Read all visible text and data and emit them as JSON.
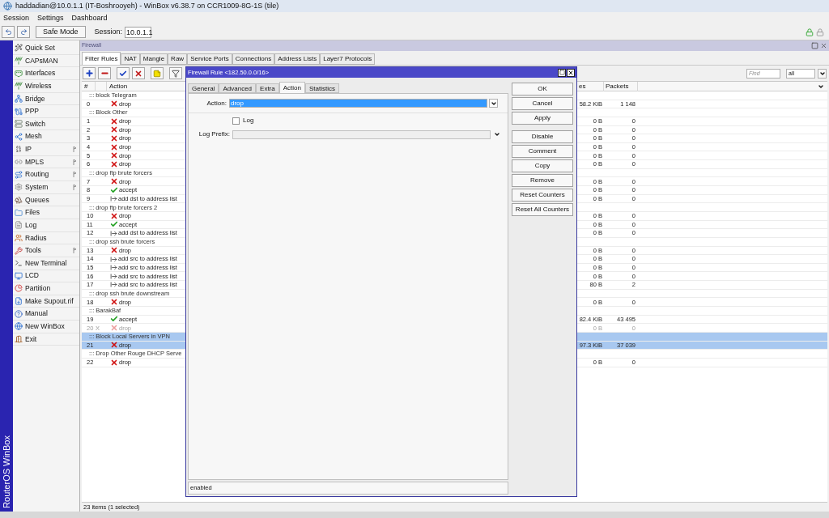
{
  "window": {
    "title": "haddadian@10.0.1.1 (IT-Boshrooyeh) - WinBox v6.38.7 on CCR1009-8G-1S (tile)"
  },
  "menu": [
    "Session",
    "Settings",
    "Dashboard"
  ],
  "toolbar": {
    "safe_mode": "Safe Mode",
    "session_label": "Session:",
    "session_value": "10.0.1.1"
  },
  "sidebar": {
    "brand": "RouterOS WinBox",
    "items": [
      {
        "label": "Quick Set",
        "has_submenu": false
      },
      {
        "label": "CAPsMAN",
        "has_submenu": false
      },
      {
        "label": "Interfaces",
        "has_submenu": false
      },
      {
        "label": "Wireless",
        "has_submenu": false
      },
      {
        "label": "Bridge",
        "has_submenu": false
      },
      {
        "label": "PPP",
        "has_submenu": false
      },
      {
        "label": "Switch",
        "has_submenu": false
      },
      {
        "label": "Mesh",
        "has_submenu": false
      },
      {
        "label": "IP",
        "has_submenu": true
      },
      {
        "label": "MPLS",
        "has_submenu": true
      },
      {
        "label": "Routing",
        "has_submenu": true
      },
      {
        "label": "System",
        "has_submenu": true
      },
      {
        "label": "Queues",
        "has_submenu": false
      },
      {
        "label": "Files",
        "has_submenu": false
      },
      {
        "label": "Log",
        "has_submenu": false
      },
      {
        "label": "Radius",
        "has_submenu": false
      },
      {
        "label": "Tools",
        "has_submenu": true
      },
      {
        "label": "New Terminal",
        "has_submenu": false
      },
      {
        "label": "LCD",
        "has_submenu": false
      },
      {
        "label": "Partition",
        "has_submenu": false
      },
      {
        "label": "Make Supout.rif",
        "has_submenu": false
      },
      {
        "label": "Manual",
        "has_submenu": false
      },
      {
        "label": "New WinBox",
        "has_submenu": false
      },
      {
        "label": "Exit",
        "has_submenu": false
      }
    ]
  },
  "firewall": {
    "title": "Firewall",
    "tabs": [
      {
        "label": "Filter Rules",
        "selected": true
      },
      {
        "label": "NAT",
        "selected": false
      },
      {
        "label": "Mangle",
        "selected": false
      },
      {
        "label": "Raw",
        "selected": false
      },
      {
        "label": "Service Ports",
        "selected": false
      },
      {
        "label": "Connections",
        "selected": false
      },
      {
        "label": "Address Lists",
        "selected": false
      },
      {
        "label": "Layer7 Protocols",
        "selected": false
      }
    ],
    "find_placeholder": "Find",
    "filter_value": "all",
    "columns": [
      "#",
      "Action",
      "es",
      "Packets"
    ],
    "rows": [
      {
        "kind": "comment",
        "text": "::: block Telegram",
        "selected": false
      },
      {
        "kind": "rule",
        "number": "0",
        "disabled": false,
        "action": {
          "kind": "drop",
          "label": "drop"
        },
        "bytes": "58.2 KiB",
        "packets": "1 148",
        "selected": false
      },
      {
        "kind": "comment",
        "text": "::: Block Other",
        "selected": false
      },
      {
        "kind": "rule",
        "number": "1",
        "disabled": false,
        "action": {
          "kind": "drop",
          "label": "drop"
        },
        "bytes": "0 B",
        "packets": "0",
        "selected": false
      },
      {
        "kind": "rule",
        "number": "2",
        "disabled": false,
        "action": {
          "kind": "drop",
          "label": "drop"
        },
        "bytes": "0 B",
        "packets": "0",
        "selected": false
      },
      {
        "kind": "rule",
        "number": "3",
        "disabled": false,
        "action": {
          "kind": "drop",
          "label": "drop"
        },
        "bytes": "0 B",
        "packets": "0",
        "selected": false
      },
      {
        "kind": "rule",
        "number": "4",
        "disabled": false,
        "action": {
          "kind": "drop",
          "label": "drop"
        },
        "bytes": "0 B",
        "packets": "0",
        "selected": false
      },
      {
        "kind": "rule",
        "number": "5",
        "disabled": false,
        "action": {
          "kind": "drop",
          "label": "drop"
        },
        "bytes": "0 B",
        "packets": "0",
        "selected": false
      },
      {
        "kind": "rule",
        "number": "6",
        "disabled": false,
        "action": {
          "kind": "drop",
          "label": "drop"
        },
        "bytes": "0 B",
        "packets": "0",
        "selected": false
      },
      {
        "kind": "comment",
        "text": "::: drop ftp brute forcers",
        "selected": false
      },
      {
        "kind": "rule",
        "number": "7",
        "disabled": false,
        "action": {
          "kind": "drop",
          "label": "drop"
        },
        "bytes": "0 B",
        "packets": "0",
        "selected": false
      },
      {
        "kind": "rule",
        "number": "8",
        "disabled": false,
        "action": {
          "kind": "accept",
          "label": "accept"
        },
        "bytes": "0 B",
        "packets": "0",
        "selected": false
      },
      {
        "kind": "rule",
        "number": "9",
        "disabled": false,
        "action": {
          "kind": "add_to_list",
          "label": "add dst to address list"
        },
        "bytes": "0 B",
        "packets": "0",
        "selected": false
      },
      {
        "kind": "comment",
        "text": "::: drop ftp brute forcers 2",
        "selected": false
      },
      {
        "kind": "rule",
        "number": "10",
        "disabled": false,
        "action": {
          "kind": "drop",
          "label": "drop"
        },
        "bytes": "0 B",
        "packets": "0",
        "selected": false
      },
      {
        "kind": "rule",
        "number": "11",
        "disabled": false,
        "action": {
          "kind": "accept",
          "label": "accept"
        },
        "bytes": "0 B",
        "packets": "0",
        "selected": false
      },
      {
        "kind": "rule",
        "number": "12",
        "disabled": false,
        "action": {
          "kind": "add_to_list",
          "label": "add dst to address list"
        },
        "bytes": "0 B",
        "packets": "0",
        "selected": false
      },
      {
        "kind": "comment",
        "text": "::: drop ssh brute forcers",
        "selected": false
      },
      {
        "kind": "rule",
        "number": "13",
        "disabled": false,
        "action": {
          "kind": "drop",
          "label": "drop"
        },
        "bytes": "0 B",
        "packets": "0",
        "selected": false
      },
      {
        "kind": "rule",
        "number": "14",
        "disabled": false,
        "action": {
          "kind": "add_to_list",
          "label": "add src to address list"
        },
        "bytes": "0 B",
        "packets": "0",
        "selected": false
      },
      {
        "kind": "rule",
        "number": "15",
        "disabled": false,
        "action": {
          "kind": "add_to_list",
          "label": "add src to address list"
        },
        "bytes": "0 B",
        "packets": "0",
        "selected": false
      },
      {
        "kind": "rule",
        "number": "16",
        "disabled": false,
        "action": {
          "kind": "add_to_list",
          "label": "add src to address list"
        },
        "bytes": "0 B",
        "packets": "0",
        "selected": false
      },
      {
        "kind": "rule",
        "number": "17",
        "disabled": false,
        "action": {
          "kind": "add_to_list",
          "label": "add src to address list"
        },
        "bytes": "80 B",
        "packets": "2",
        "selected": false
      },
      {
        "kind": "comment",
        "text": "::: drop ssh brute downstream",
        "selected": false
      },
      {
        "kind": "rule",
        "number": "18",
        "disabled": false,
        "action": {
          "kind": "drop",
          "label": "drop"
        },
        "bytes": "0 B",
        "packets": "0",
        "selected": false
      },
      {
        "kind": "comment",
        "text": "::: BarakBaf",
        "selected": false
      },
      {
        "kind": "rule",
        "number": "19",
        "disabled": false,
        "action": {
          "kind": "accept",
          "label": "accept"
        },
        "bytes": "82.4 KiB",
        "packets": "43 495",
        "selected": false
      },
      {
        "kind": "rule",
        "number": "20",
        "disabled": true,
        "flag": "X",
        "action": {
          "kind": "drop",
          "label": "drop"
        },
        "bytes": "0 B",
        "packets": "0",
        "selected": false
      },
      {
        "kind": "comment",
        "text": "::: Block Local Servers in VPN",
        "selected": true
      },
      {
        "kind": "rule",
        "number": "21",
        "disabled": false,
        "action": {
          "kind": "drop",
          "label": "drop"
        },
        "bytes": "97.3 KiB",
        "packets": "37 039",
        "selected": true
      },
      {
        "kind": "comment",
        "text": "::: Drop Other Rouge DHCP Serve",
        "selected": false
      },
      {
        "kind": "rule",
        "number": "22",
        "disabled": false,
        "action": {
          "kind": "drop",
          "label": "drop"
        },
        "bytes": "0 B",
        "packets": "0",
        "selected": false
      }
    ],
    "status": "23 items (1 selected)"
  },
  "dialog": {
    "title": "Firewall Rule <182.50.0.0/16>",
    "tabs": [
      {
        "label": "General",
        "selected": false
      },
      {
        "label": "Advanced",
        "selected": false
      },
      {
        "label": "Extra",
        "selected": false
      },
      {
        "label": "Action",
        "selected": true
      },
      {
        "label": "Statistics",
        "selected": false
      }
    ],
    "action_label": "Action:",
    "action_value": "drop",
    "log": {
      "label": "Log",
      "checked": false
    },
    "log_prefix_label": "Log Prefix:",
    "button_groups": [
      [
        "OK",
        "Cancel",
        "Apply"
      ],
      [
        "Disable",
        "Comment",
        "Copy",
        "Remove",
        "Reset Counters",
        "Reset All Counters"
      ]
    ],
    "status": "enabled"
  }
}
